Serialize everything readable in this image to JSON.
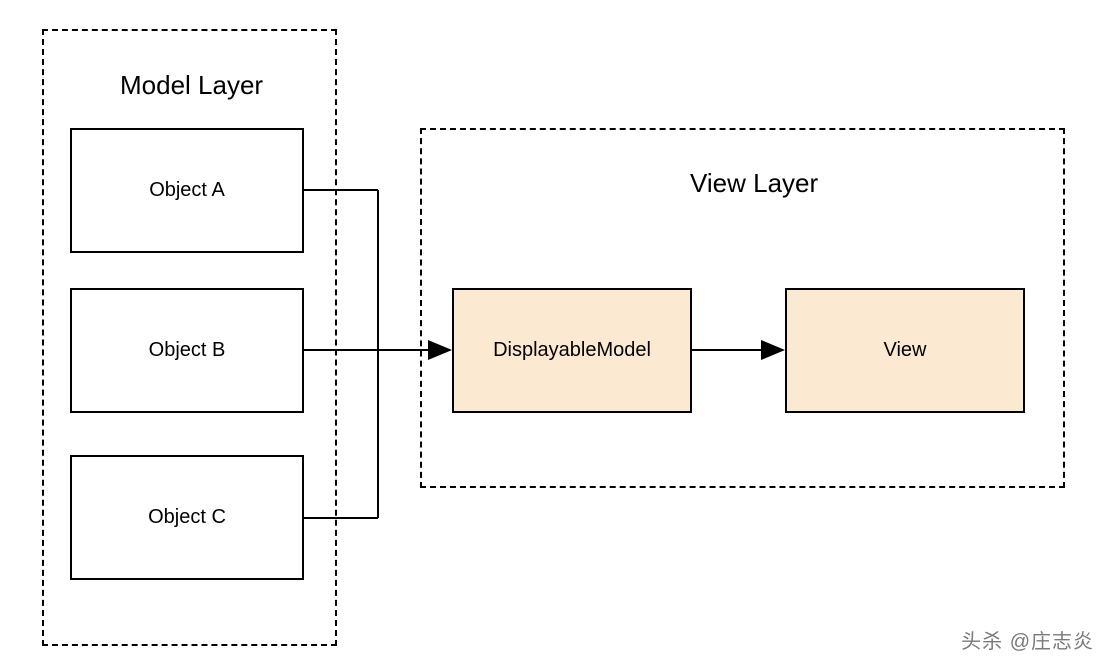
{
  "modelLayer": {
    "title": "Model Layer",
    "objects": [
      "Object A",
      "Object B",
      "Object C"
    ]
  },
  "viewLayer": {
    "title": "View Layer",
    "displayableModel": "DisplayableModel",
    "view": "View"
  },
  "watermark": "头杀 @庄志炎",
  "colors": {
    "nodeFill": "#fce9d1",
    "border": "#000000",
    "background": "#ffffff"
  }
}
